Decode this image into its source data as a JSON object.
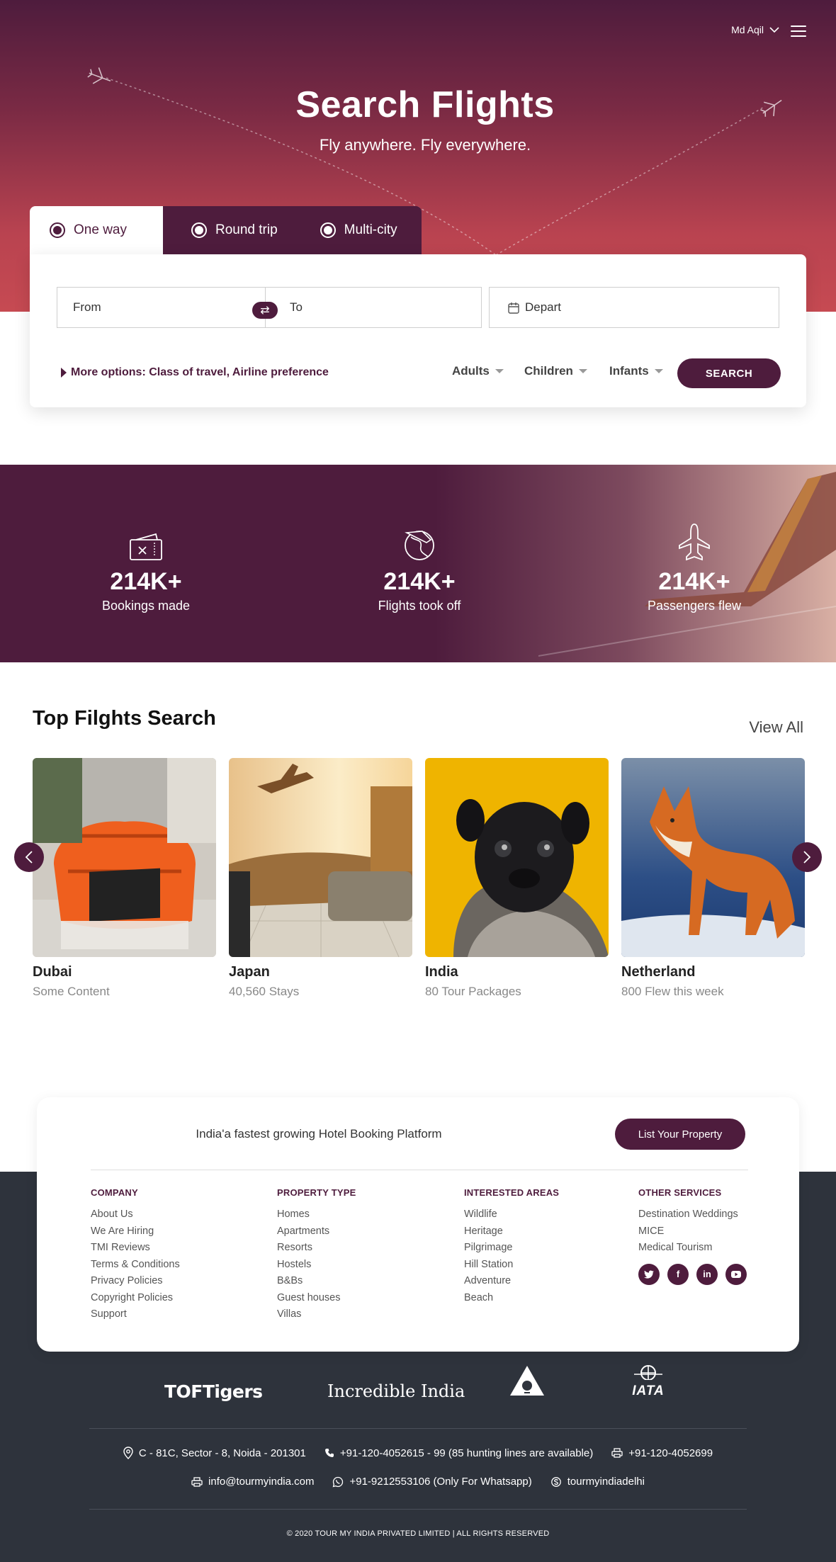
{
  "colors": {
    "brand": "#4e1c3d",
    "hero_bottom": "#c64a52",
    "footer_bg": "#2e333c"
  },
  "header": {
    "user_name": "Md Aqil",
    "menu_icon": "hamburger-icon"
  },
  "hero": {
    "title": "Search Flights",
    "subtitle": "Fly anywhere. Fly everywhere."
  },
  "search": {
    "trip_types": [
      {
        "label": "One way",
        "selected": true
      },
      {
        "label": "Round trip",
        "selected": false
      },
      {
        "label": "Multi-city",
        "selected": false
      }
    ],
    "from_placeholder": "From",
    "to_placeholder": "To",
    "depart_placeholder": "Depart",
    "more_options": "More options: Class of travel, Airline preference",
    "adults": "Adults",
    "children": "Children",
    "infants": "Infants",
    "button": "SEARCH"
  },
  "stats": [
    {
      "value": "214K+",
      "label": "Bookings made",
      "icon": "ticket-icon"
    },
    {
      "value": "214K+",
      "label": "Flights took off",
      "icon": "globe-plane-icon"
    },
    {
      "value": "214K+",
      "label": "Passengers flew",
      "icon": "airplane-icon"
    }
  ],
  "top_flights": {
    "title": "Top Filghts Search",
    "view_all": "View All",
    "cards": [
      {
        "name": "Dubai",
        "sub": "Some Content"
      },
      {
        "name": "Japan",
        "sub": "40,560 Stays"
      },
      {
        "name": "India",
        "sub": "80 Tour Packages"
      },
      {
        "name": "Netherland",
        "sub": "800 Flew this week"
      }
    ]
  },
  "footer": {
    "tagline": "India'a fastest growing Hotel Booking Platform",
    "list_property": "List Your Property",
    "columns": [
      {
        "title": "COMPANY",
        "items": [
          "About Us",
          "We Are Hiring",
          "TMI Reviews",
          "Terms & Conditions",
          "Privacy Policies",
          "Copyright Policies",
          "Support"
        ]
      },
      {
        "title": "PROPERTY TYPE",
        "items": [
          "Homes",
          "Apartments",
          "Resorts",
          "Hostels",
          "B&Bs",
          "Guest houses",
          "Villas"
        ]
      },
      {
        "title": "INTERESTED AREAS",
        "items": [
          "Wildlife",
          "Heritage",
          "Pilgrimage",
          "Hill Station",
          "Adventure",
          "Beach"
        ]
      },
      {
        "title": "OTHER SERVICES",
        "items": [
          "Destination Weddings",
          "MICE",
          "Medical Tourism"
        ]
      }
    ],
    "socials": [
      "twitter-icon",
      "facebook-icon",
      "linkedin-icon",
      "youtube-icon"
    ],
    "partners": {
      "toftigers": "TOFTigers",
      "incredible": "Incredible India",
      "iata": "IATA"
    },
    "address": "C - 81C, Sector - 8, Noida - 201301",
    "phone": "+91-120-4052615 - 99 (85 hunting lines are available)",
    "fax": "+91-120-4052699",
    "email": "info@tourmyindia.com",
    "whatsapp": "+91-9212553106 (Only For Whatsapp)",
    "skype": "tourmyindiadelhi",
    "copyright": "© 2020 TOUR MY INDIA PRIVATED LIMITED | ALL RIGHTS RESERVED"
  }
}
